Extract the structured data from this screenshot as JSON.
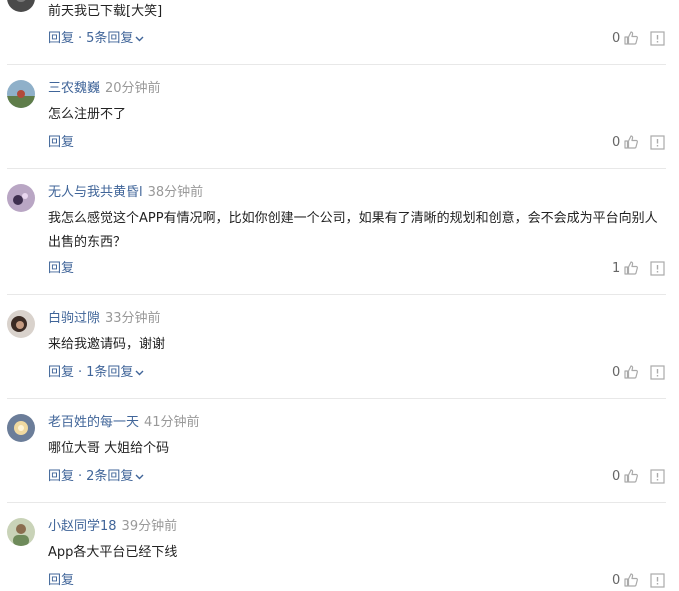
{
  "comments": [
    {
      "content": "前天我已下载[大笑]",
      "reply_label": "回复",
      "reply_sep": "·",
      "replies_label": "5条回复",
      "likes": "0"
    },
    {
      "username": "三农魏巍",
      "time": "20分钟前",
      "content": "怎么注册不了",
      "reply_label": "回复",
      "likes": "0"
    },
    {
      "username": "无人与我共黄昏l",
      "time": "38分钟前",
      "content": "我怎么感觉这个APP有情况啊，比如你创建一个公司，如果有了清晰的规划和创意，会不会成为平台向别人出售的东西？",
      "reply_label": "回复",
      "likes": "1"
    },
    {
      "username": "白驹过隙",
      "time": "33分钟前",
      "content": "来给我邀请码，谢谢",
      "reply_label": "回复",
      "reply_sep": "·",
      "replies_label": "1条回复",
      "likes": "0"
    },
    {
      "username": "老百姓的每一天",
      "time": "41分钟前",
      "content": "哪位大哥 大姐给个码",
      "reply_label": "回复",
      "reply_sep": "·",
      "replies_label": "2条回复",
      "likes": "0"
    },
    {
      "username": "小赵同学18",
      "time": "39分钟前",
      "content": "App各大平台已经下线",
      "reply_label": "回复",
      "likes": "0"
    }
  ],
  "icons": {
    "like": "thumbs-up-icon",
    "report": "report-icon",
    "expand": "chevron-down-icon"
  },
  "colors": {
    "link": "#406599",
    "meta": "#999999",
    "text": "#222222",
    "icon": "#aaaaaa",
    "divider": "#e8e8e8"
  }
}
